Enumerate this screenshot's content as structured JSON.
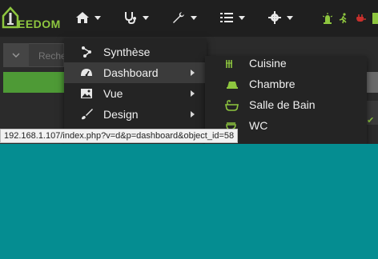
{
  "app": {
    "logo_text": "EEDOM",
    "colors": {
      "accent": "#8ec63f",
      "navbar": "#1f1f1f",
      "menu": "#242424",
      "desktop": "#058d91"
    }
  },
  "navbar": {
    "items": [
      {
        "icon": "home-icon"
      },
      {
        "icon": "stethoscope-icon"
      },
      {
        "icon": "wrench-icon"
      },
      {
        "icon": "tasks-icon"
      },
      {
        "icon": "gear-icon"
      }
    ],
    "status_icons": [
      "alarm-light-icon",
      "running-person-icon",
      "plug-icon",
      "status-square-icon"
    ]
  },
  "background": {
    "search_placeholder": "Reche"
  },
  "menu": {
    "items": [
      {
        "label": "Synthèse",
        "icon": "sitemap-icon",
        "has_submenu": false
      },
      {
        "label": "Dashboard",
        "icon": "dashboard-icon",
        "has_submenu": true
      },
      {
        "label": "Vue",
        "icon": "image-icon",
        "has_submenu": true
      },
      {
        "label": "Design",
        "icon": "paintbrush-icon",
        "has_submenu": true
      }
    ]
  },
  "submenu": {
    "items": [
      {
        "label": "Cuisine",
        "icon": "kitchen-icon"
      },
      {
        "label": "Chambre",
        "icon": "bed-icon"
      },
      {
        "label": "Salle de Bain",
        "icon": "bathtub-icon"
      },
      {
        "label": "WC",
        "icon": "toilet-icon"
      }
    ]
  },
  "statusbar": {
    "url": "192.168.1.107/index.php?v=d&p=dashboard&object_id=58"
  }
}
